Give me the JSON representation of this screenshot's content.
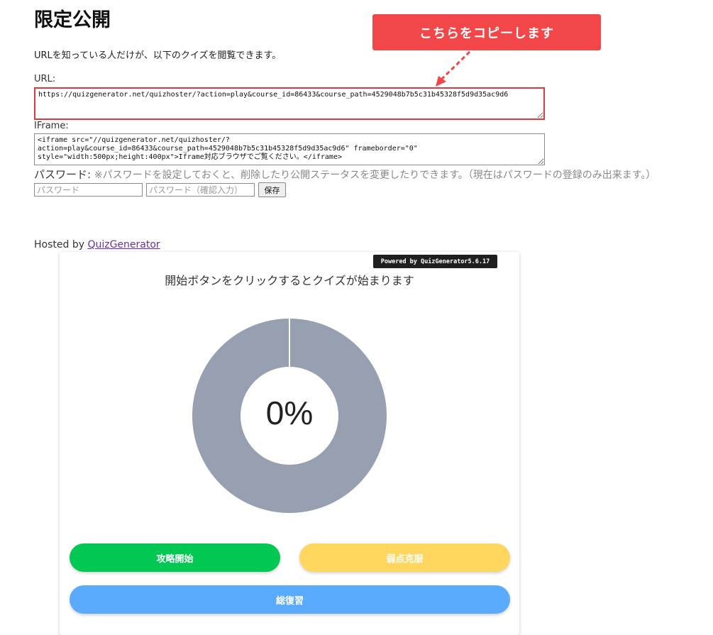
{
  "page": {
    "title": "限定公開",
    "description": "URLを知っている人だけが、以下のクイズを閲覧できます。",
    "url_label": "URL:",
    "url_value": "https://quizgenerator.net/quizhoster/?action=play&course_id=86433&course_path=4529048b7b5c31b45328f5d9d35ac9d6",
    "iframe_label": "IFrame:",
    "iframe_value": "<iframe src=\"//quizgenerator.net/quizhoster/?action=play&course_id=86433&course_path=4529048b7b5c31b45328f5d9d35ac9d6\" frameborder=\"0\" style=\"width:500px;height:400px\">Iframe対応ブラウザでご覧ください。</iframe>",
    "password_label": "パスワード:",
    "password_note": "※パスワードを設定しておくと、削除したり公開ステータスを変更したりできます。（現在はパスワードの登録のみ出来ます。）",
    "password_placeholder": "パスワード",
    "password_confirm_placeholder": "パスワード（確認入力）",
    "save_label": "保存",
    "hosted_prefix": "Hosted by ",
    "hosted_link": "QuizGenerator"
  },
  "callout": {
    "text": "こちらをコピーします",
    "color": "#f24649"
  },
  "quiz": {
    "powered_by": "Powered by QuizGenerator5.6.17",
    "instruction": "開始ボタンをクリックするとクイズが始まります",
    "progress_text": "0%",
    "progress_fraction": 0,
    "donut_color": "#96a0b0",
    "buttons": {
      "start": "攻略開始",
      "weak": "弱点克服",
      "review": "総復習"
    },
    "button_colors": {
      "start": "#00c853",
      "weak": "#ffd75e",
      "review": "#5aabfd"
    }
  }
}
